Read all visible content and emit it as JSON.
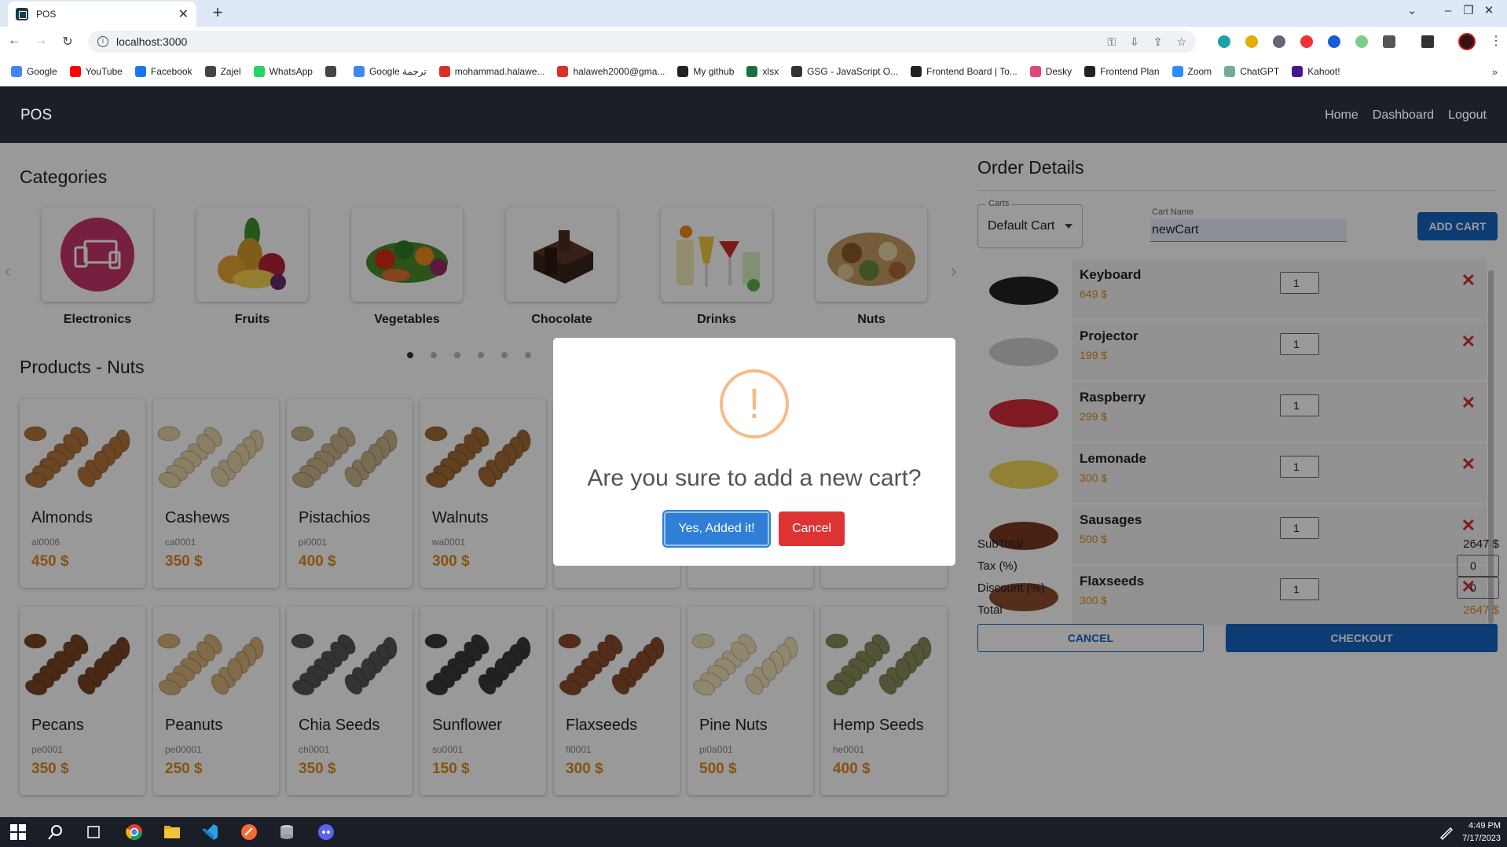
{
  "browser": {
    "tab_title": "POS",
    "tab_close": "✕",
    "new_tab": "+",
    "url": "localhost:3000",
    "bookmarks": [
      {
        "label": "Google",
        "color": "#4285f4"
      },
      {
        "label": "YouTube",
        "color": "#ff0000"
      },
      {
        "label": "Facebook",
        "color": "#1877f2"
      },
      {
        "label": "Zajel",
        "color": "#444444"
      },
      {
        "label": "WhatsApp",
        "color": "#25d366"
      },
      {
        "label": "",
        "color": "#444444"
      },
      {
        "label": "Google ترجمة",
        "color": "#4285f4"
      },
      {
        "label": "mohammad.halawe...",
        "color": "#d93025"
      },
      {
        "label": "halaweh2000@gma...",
        "color": "#d93025"
      },
      {
        "label": "My github",
        "color": "#222222"
      },
      {
        "label": "xlsx",
        "color": "#1d6f42"
      },
      {
        "label": "GSG - JavaScript O...",
        "color": "#333333"
      },
      {
        "label": "Frontend Board | To...",
        "color": "#222222"
      },
      {
        "label": "Desky",
        "color": "#e0457b"
      },
      {
        "label": "Frontend Plan",
        "color": "#222222"
      },
      {
        "label": "Zoom",
        "color": "#2d8cff"
      },
      {
        "label": "ChatGPT",
        "color": "#74aa9c"
      },
      {
        "label": "Kahoot!",
        "color": "#46178f"
      }
    ],
    "more_bookmarks": "»"
  },
  "app": {
    "brand": "POS",
    "nav": [
      "Home",
      "Dashboard",
      "Logout"
    ]
  },
  "categories": {
    "title": "Categories",
    "items": [
      {
        "label": "Electronics",
        "icon": "electronics-icon"
      },
      {
        "label": "Fruits",
        "icon": "fruits-icon"
      },
      {
        "label": "Vegetables",
        "icon": "vegetables-icon"
      },
      {
        "label": "Chocolate",
        "icon": "chocolate-icon"
      },
      {
        "label": "Drinks",
        "icon": "drinks-icon"
      },
      {
        "label": "Nuts",
        "icon": "nuts-icon"
      }
    ]
  },
  "products": {
    "title": "Products - Nuts",
    "items": [
      {
        "name": "Almonds",
        "code": "al0006",
        "price": "450 $",
        "color": "#b5753a"
      },
      {
        "name": "Cashews",
        "code": "ca0001",
        "price": "350 $",
        "color": "#e6d3a8"
      },
      {
        "name": "Pistachios",
        "code": "pi0001",
        "price": "400 $",
        "color": "#c9b48a"
      },
      {
        "name": "Walnuts",
        "code": "wa0001",
        "price": "300 $",
        "color": "#a26a34"
      },
      {
        "name": "",
        "code": "",
        "price": "",
        "color": "#cccccc"
      },
      {
        "name": "",
        "code": "",
        "price": "",
        "color": "#cccccc"
      },
      {
        "name": "",
        "code": "",
        "price": "",
        "color": "#cccccc"
      },
      {
        "name": "Pecans",
        "code": "pe0001",
        "price": "350 $",
        "color": "#7b4526"
      },
      {
        "name": "Peanuts",
        "code": "pe00001",
        "price": "250 $",
        "color": "#d9b27a"
      },
      {
        "name": "Chia Seeds",
        "code": "ch0001",
        "price": "350 $",
        "color": "#555555"
      },
      {
        "name": "Sunflower",
        "code": "su0001",
        "price": "150 $",
        "color": "#3a3a3a"
      },
      {
        "name": "Flaxseeds",
        "code": "fl0001",
        "price": "300 $",
        "color": "#8a4b2a"
      },
      {
        "name": "Pine Nuts",
        "code": "pi0a001",
        "price": "500 $",
        "color": "#efe2b8"
      },
      {
        "name": "Hemp Seeds",
        "code": "he0001",
        "price": "400 $",
        "color": "#8a8a5a"
      }
    ]
  },
  "order": {
    "title": "Order Details",
    "carts_label": "Carts",
    "carts_value": "Default Cart",
    "cart_name_label": "Cart Name",
    "cart_name_value": "newCart",
    "add_cart": "ADD CART",
    "items": [
      {
        "name": "Keyboard",
        "price": "649 $",
        "qty": "1",
        "color": "#222222"
      },
      {
        "name": "Projector",
        "price": "199 $",
        "qty": "1",
        "color": "#cfcfcf"
      },
      {
        "name": "Raspberry",
        "price": "299 $",
        "qty": "1",
        "color": "#d42a3a"
      },
      {
        "name": "Lemonade",
        "price": "300 $",
        "qty": "1",
        "color": "#f0d85a"
      },
      {
        "name": "Sausages",
        "price": "500 $",
        "qty": "1",
        "color": "#7a3a20"
      },
      {
        "name": "Flaxseeds",
        "price": "300 $",
        "qty": "1",
        "color": "#8a4b2a"
      }
    ],
    "remove_symbol": "✕",
    "subtotal_label": "SubTotal",
    "subtotal_value": "2647 $",
    "tax_label": "Tax (%)",
    "tax_value": "0",
    "discount_label": "Discount (%)",
    "discount_value": "0",
    "total_label": "Total",
    "total_value": "2647 $",
    "cancel": "CANCEL",
    "checkout": "CHECKOUT"
  },
  "modal": {
    "icon_symbol": "!",
    "text": "Are you sure to add a new cart?",
    "confirm": "Yes, Added it!",
    "cancel": "Cancel"
  },
  "taskbar": {
    "time": "4:49 PM",
    "date": "7/17/2023"
  }
}
